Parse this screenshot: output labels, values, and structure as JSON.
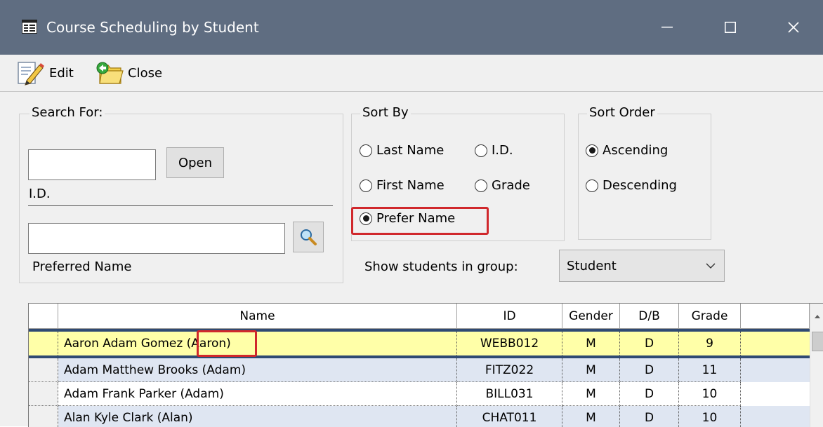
{
  "window": {
    "title": "Course Scheduling by Student",
    "minimize_glyph": "—",
    "maximize_glyph": "☐",
    "close_glyph": "✕"
  },
  "toolbar": {
    "edit_label": "Edit",
    "close_label": "Close"
  },
  "search": {
    "legend": "Search For:",
    "id_value": "",
    "open_label": "Open",
    "id_label": "I.D.",
    "preferred_value": "",
    "preferred_label": "Preferred Name"
  },
  "sort_by": {
    "legend": "Sort By",
    "options": [
      {
        "label": "Last Name",
        "selected": false
      },
      {
        "label": "I.D.",
        "selected": false
      },
      {
        "label": "First Name",
        "selected": false
      },
      {
        "label": "Grade",
        "selected": false
      },
      {
        "label": "Prefer Name",
        "selected": true
      }
    ]
  },
  "sort_order": {
    "legend": "Sort Order",
    "options": [
      {
        "label": "Ascending",
        "selected": true
      },
      {
        "label": "Descending",
        "selected": false
      }
    ]
  },
  "group_filter": {
    "label": "Show students in group:",
    "selected": "Student"
  },
  "grid": {
    "columns": [
      "Name",
      "ID",
      "Gender",
      "D/B",
      "Grade"
    ],
    "rows": [
      {
        "name": "Aaron Adam Gomez (Aaron)",
        "id": "WEBB012",
        "gender": "M",
        "db": "D",
        "grade": "9",
        "selected": true
      },
      {
        "name": "Adam Matthew Brooks (Adam)",
        "id": "FITZ022",
        "gender": "M",
        "db": "D",
        "grade": "11",
        "selected": false
      },
      {
        "name": "Adam Frank Parker (Adam)",
        "id": "BILL031",
        "gender": "M",
        "db": "D",
        "grade": "10",
        "selected": false
      },
      {
        "name": "Alan Kyle Clark (Alan)",
        "id": "CHAT011",
        "gender": "M",
        "db": "D",
        "grade": "10",
        "selected": false
      }
    ]
  },
  "colors": {
    "titlebar": "#5f6d81",
    "selected_row": "#ffffa8",
    "alt_row": "#dfe6f2",
    "selection_border": "#2f4a73",
    "highlight_box": "#d0282c"
  }
}
